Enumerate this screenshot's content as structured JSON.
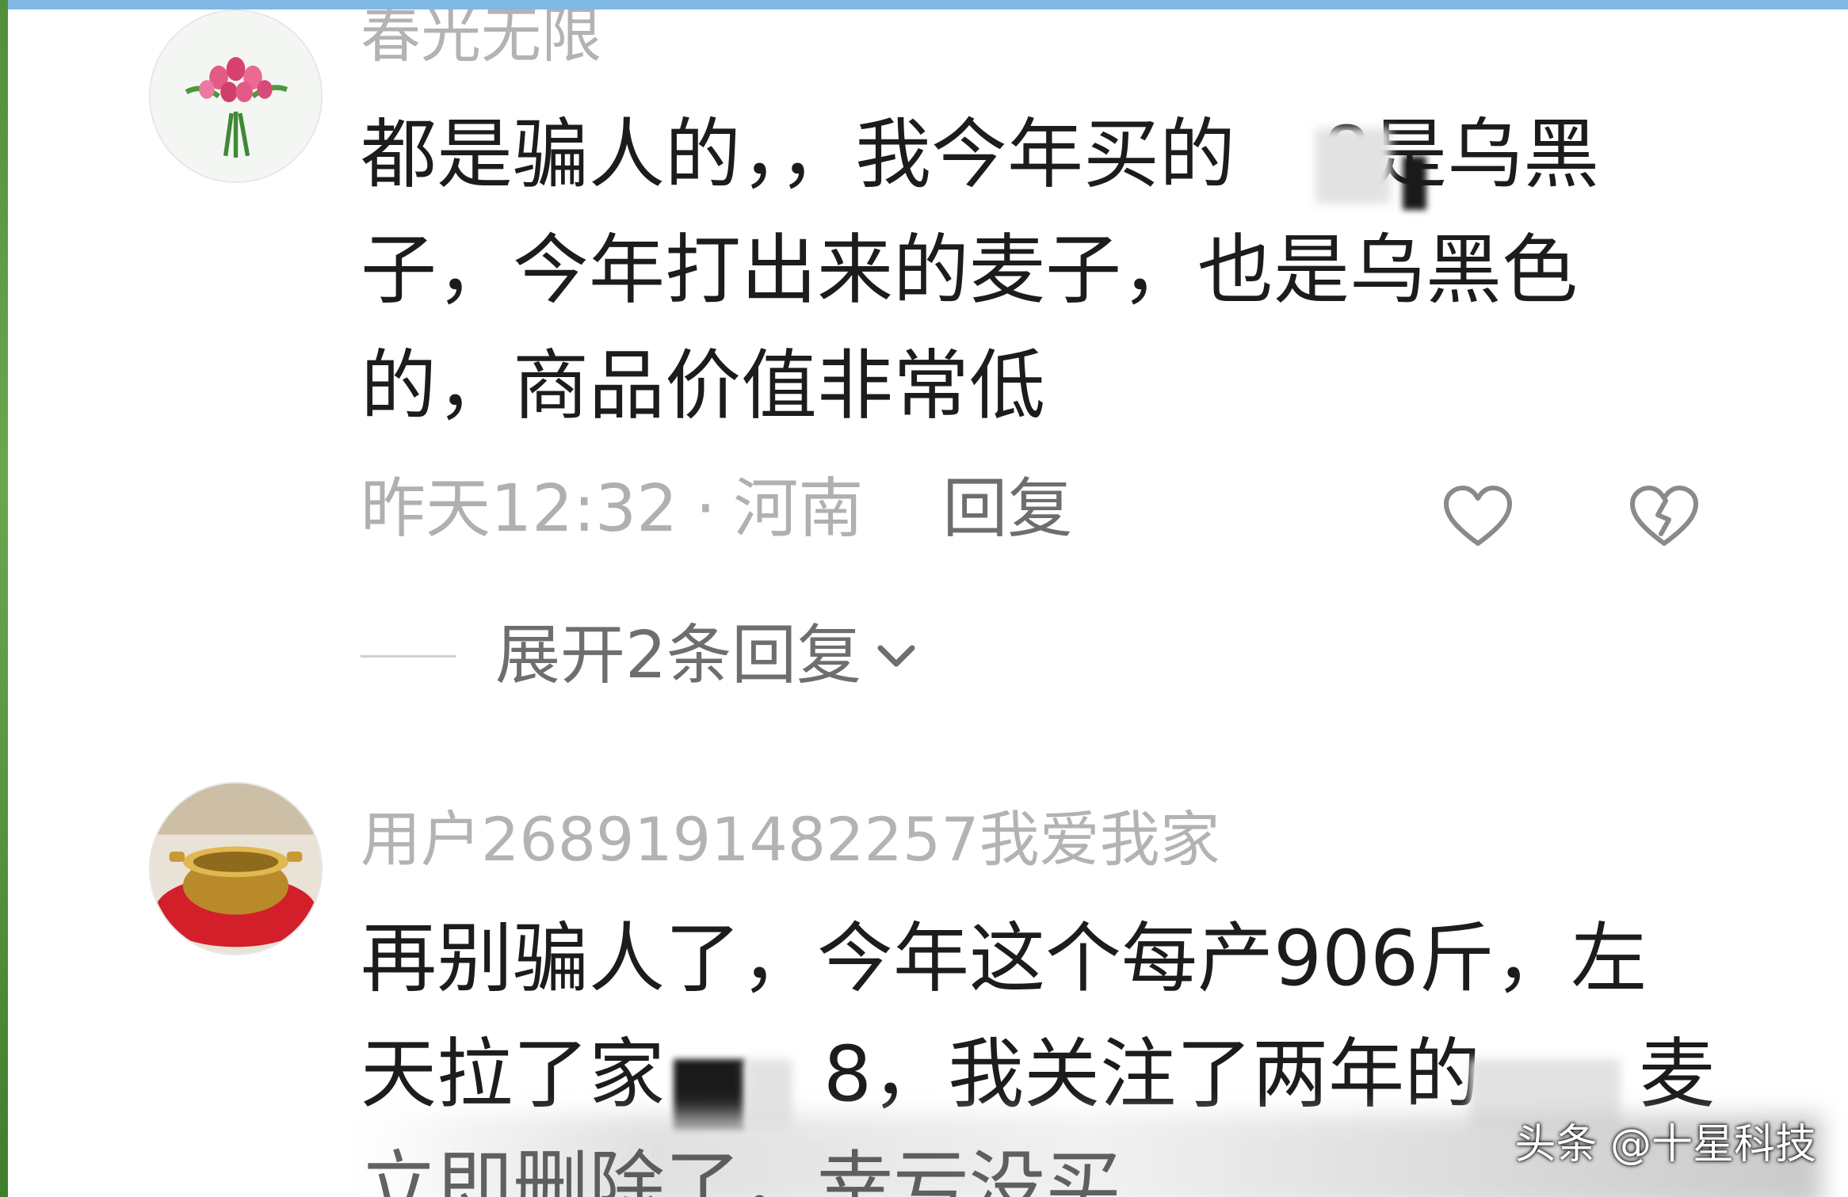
{
  "comments": [
    {
      "username": "春光无限",
      "text_lines": [
        "都是骗人的，，我今年买的",
        "8是乌黑",
        "子，今年打出来的麦子，也是乌黑色",
        "的，商品价值非常低"
      ],
      "time": "昨天12:32",
      "separator": "·",
      "location": "河南",
      "reply_label": "回复",
      "expand_label": "展开2条回复",
      "avatar_icon": "tulip-bouquet"
    },
    {
      "username": "用户2689191482257我爱我家",
      "text_lines": [
        "再别骗人了，今年这个每产906斤，左",
        "天拉了家",
        "8，我关注了两年的",
        "麦",
        "立即删除了，幸亏没买"
      ],
      "avatar_icon": "brass-bowl"
    }
  ],
  "watermark": "头条 @十星科技",
  "icons": {
    "like": "heart-outline-icon",
    "dislike": "broken-heart-icon",
    "expand": "chevron-down-icon"
  },
  "colors": {
    "username": "#b3b3b3",
    "text": "#1c1c1c",
    "meta": "#b0b0b0",
    "reply": "#6e6e6e"
  }
}
